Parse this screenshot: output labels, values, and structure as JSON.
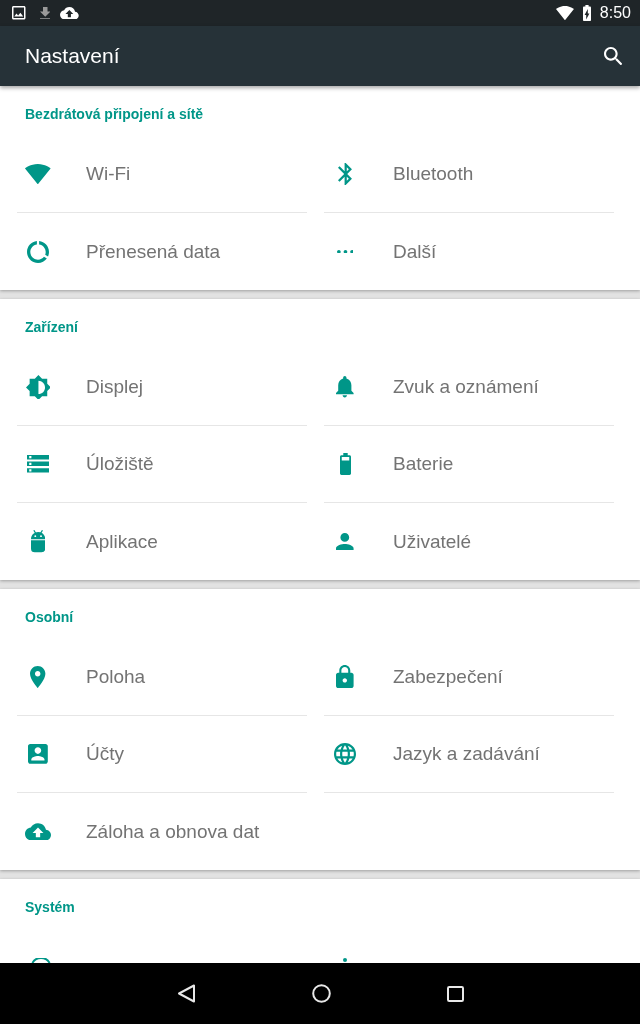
{
  "status_bar": {
    "time": "8:50"
  },
  "app_bar": {
    "title": "Nastavení"
  },
  "sections": [
    {
      "title": "Bezdrátová připojení a sítě",
      "items": [
        "Wi-Fi",
        "Bluetooth",
        "Přenesená data",
        "Další"
      ]
    },
    {
      "title": "Zařízení",
      "items": [
        "Displej",
        "Zvuk a oznámení",
        "Úložiště",
        "Baterie",
        "Aplikace",
        "Uživatelé"
      ]
    },
    {
      "title": "Osobní",
      "items": [
        "Poloha",
        "Zabezpečení",
        "Účty",
        "Jazyk a zadávání",
        "Záloha a obnova dat"
      ]
    },
    {
      "title": "Systém"
    }
  ]
}
